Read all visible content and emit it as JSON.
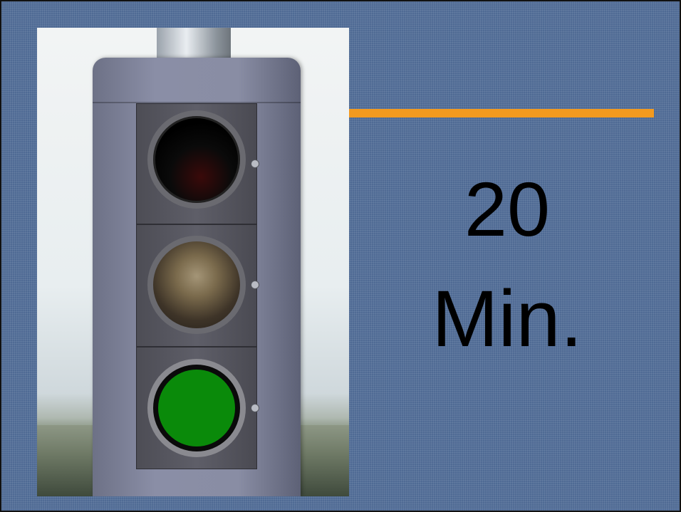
{
  "slide": {
    "title_number": "20",
    "title_unit": "Min."
  },
  "photo": {
    "subject_icon": "traffic-light-green-icon"
  },
  "colors": {
    "background": "#4f6a94",
    "accent_bar": "#f39a1f",
    "text": "#000000",
    "green_light": "#0a8a0a"
  }
}
